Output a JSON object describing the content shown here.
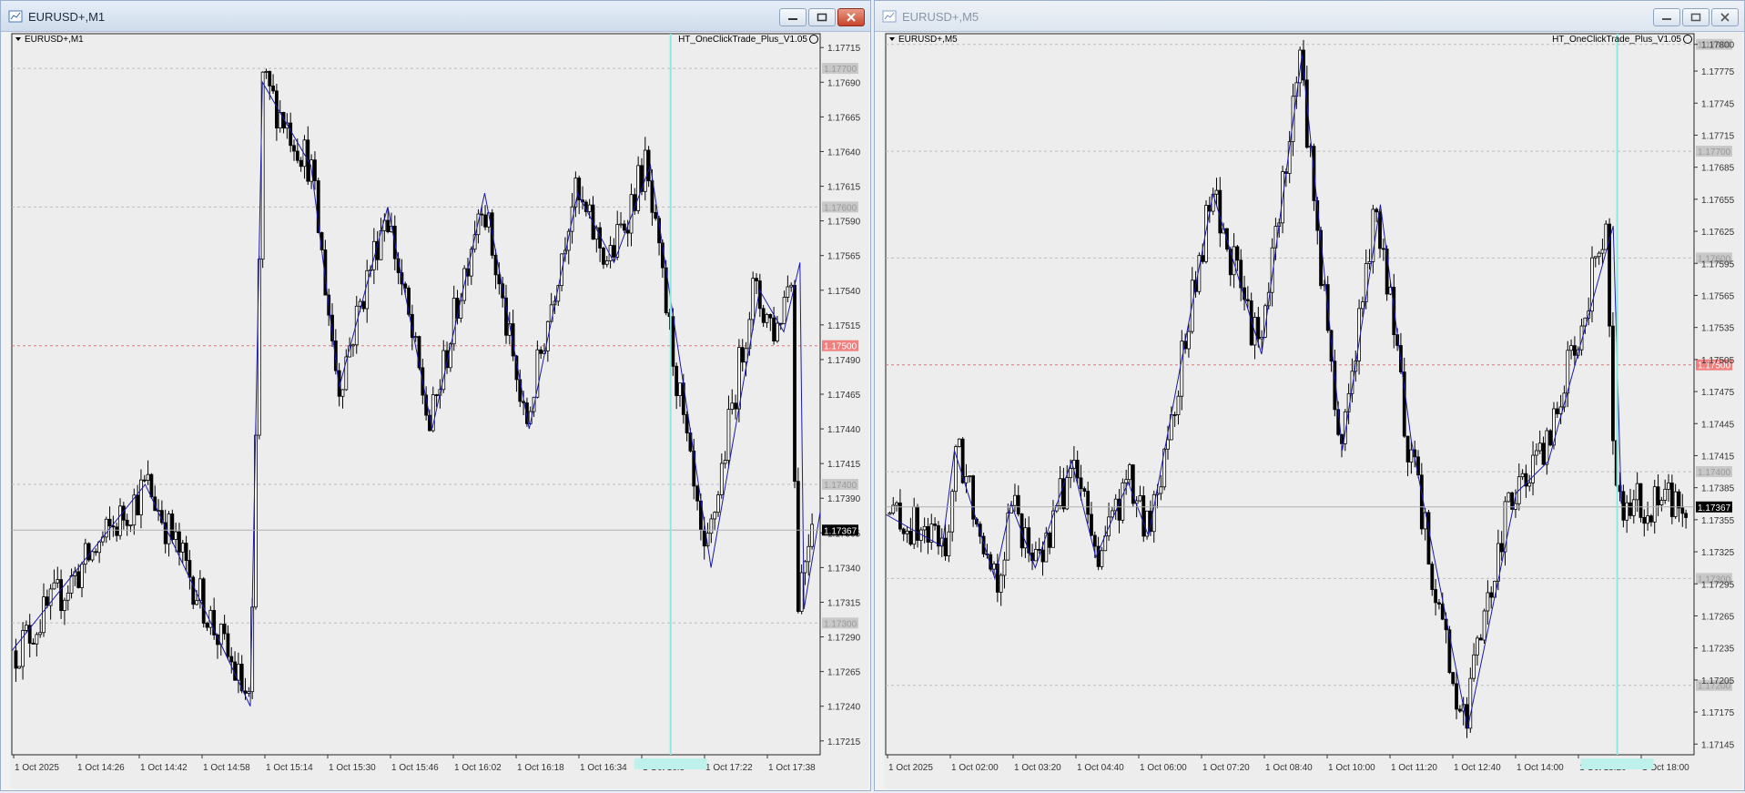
{
  "windows": [
    {
      "title": "EURUSD+,M1",
      "chart_label": "EURUSD+,M1",
      "indicator": "HT_OneClickTrade_Plus_V1.05"
    },
    {
      "title": "EURUSD+,M5",
      "chart_label": "EURUSD+,M5",
      "indicator": "HT_OneClickTrade_Plus_V1.05"
    }
  ],
  "colors": {
    "zigzag": "#1a1aa8",
    "bid_line": "#b0b0b0",
    "level_red": "#f07070",
    "cursor_line": "#8fe8e0",
    "candle": "#000000"
  },
  "chart_data": [
    {
      "type": "candlestick",
      "symbol": "EURUSD+",
      "timeframe": "M1",
      "current_price": "1.17367",
      "ylim": [
        1.17205,
        1.17725
      ],
      "y_ticks": [
        "1.17715",
        "1.17690",
        "1.17665",
        "1.17640",
        "1.17615",
        "1.17590",
        "1.17565",
        "1.17540",
        "1.17515",
        "1.17490",
        "1.17465",
        "1.17440",
        "1.17415",
        "1.17390",
        "1.17365",
        "1.17340",
        "1.17315",
        "1.17290",
        "1.17265",
        "1.17240",
        "1.17215"
      ],
      "x_ticks": [
        "1 Oct 2025",
        "1 Oct 14:26",
        "1 Oct 14:42",
        "1 Oct 14:58",
        "1 Oct 15:14",
        "1 Oct 15:30",
        "1 Oct 15:46",
        "1 Oct 16:02",
        "1 Oct 16:18",
        "1 Oct 16:34",
        "1 Oct 16:5",
        "1 Oct 17:22",
        "1 Oct 17:38"
      ],
      "levels": [
        {
          "price": 1.177,
          "label": "1.17700",
          "style": "gray"
        },
        {
          "price": 1.176,
          "label": "1.17600",
          "style": "gray"
        },
        {
          "price": 1.175,
          "label": "1.17500",
          "style": "red"
        },
        {
          "price": 1.174,
          "label": "1.17400",
          "style": "gray"
        },
        {
          "price": 1.173,
          "label": "1.17300",
          "style": "gray"
        }
      ],
      "cursor_x": 0.815,
      "zigzag": [
        [
          0.0,
          1.1728
        ],
        [
          0.165,
          1.174
        ],
        [
          0.295,
          1.1724
        ],
        [
          0.31,
          1.1769
        ],
        [
          0.37,
          1.1763
        ],
        [
          0.405,
          1.1747
        ],
        [
          0.465,
          1.176
        ],
        [
          0.52,
          1.1744
        ],
        [
          0.585,
          1.1761
        ],
        [
          0.64,
          1.1744
        ],
        [
          0.7,
          1.1761
        ],
        [
          0.745,
          1.1756
        ],
        [
          0.79,
          1.1763
        ],
        [
          0.865,
          1.1734
        ],
        [
          0.925,
          1.1754
        ],
        [
          0.955,
          1.1751
        ],
        [
          0.975,
          1.1756
        ],
        [
          0.98,
          1.1731
        ],
        [
          1.0,
          1.1738
        ]
      ]
    },
    {
      "type": "candlestick",
      "symbol": "EURUSD+",
      "timeframe": "M5",
      "current_price": "1.17367",
      "ylim": [
        1.17135,
        1.1781
      ],
      "y_ticks": [
        "1.17800",
        "1.17775",
        "1.17745",
        "1.17715",
        "1.17685",
        "1.17655",
        "1.17625",
        "1.17595",
        "1.17565",
        "1.17535",
        "1.17505",
        "1.17475",
        "1.17445",
        "1.17415",
        "1.17385",
        "1.17355",
        "1.17325",
        "1.17295",
        "1.17265",
        "1.17235",
        "1.17205",
        "1.17175",
        "1.17145"
      ],
      "x_ticks": [
        "1 Oct 2025",
        "1 Oct 02:00",
        "1 Oct 03:20",
        "1 Oct 04:40",
        "1 Oct 06:00",
        "1 Oct 07:20",
        "1 Oct 08:40",
        "1 Oct 10:00",
        "1 Oct 11:20",
        "1 Oct 12:40",
        "1 Oct 14:00",
        "1 Oct 15:20",
        "1 Oct 18:00"
      ],
      "levels": [
        {
          "price": 1.178,
          "label": "1.17800",
          "style": "gray"
        },
        {
          "price": 1.177,
          "label": "1.17700",
          "style": "gray"
        },
        {
          "price": 1.176,
          "label": "1.17600",
          "style": "gray"
        },
        {
          "price": 1.175,
          "label": "1.17500",
          "style": "red"
        },
        {
          "price": 1.174,
          "label": "1.17400",
          "style": "gray"
        },
        {
          "price": 1.173,
          "label": "1.17300",
          "style": "gray"
        },
        {
          "price": 1.172,
          "label": "1.17200",
          "style": "gray"
        }
      ],
      "cursor_x": 0.905,
      "zigzag": [
        [
          0.0,
          1.1736
        ],
        [
          0.07,
          1.1733
        ],
        [
          0.085,
          1.1742
        ],
        [
          0.135,
          1.173
        ],
        [
          0.155,
          1.1737
        ],
        [
          0.185,
          1.1731
        ],
        [
          0.23,
          1.1741
        ],
        [
          0.26,
          1.1732
        ],
        [
          0.3,
          1.1739
        ],
        [
          0.325,
          1.1734
        ],
        [
          0.405,
          1.1766
        ],
        [
          0.465,
          1.1751
        ],
        [
          0.515,
          1.1779
        ],
        [
          0.565,
          1.1742
        ],
        [
          0.612,
          1.1765
        ],
        [
          0.65,
          1.1743
        ],
        [
          0.72,
          1.1716
        ],
        [
          0.78,
          1.1738
        ],
        [
          0.82,
          1.1741
        ],
        [
          0.9,
          1.1763
        ],
        [
          0.91,
          1.1737
        ]
      ]
    }
  ]
}
